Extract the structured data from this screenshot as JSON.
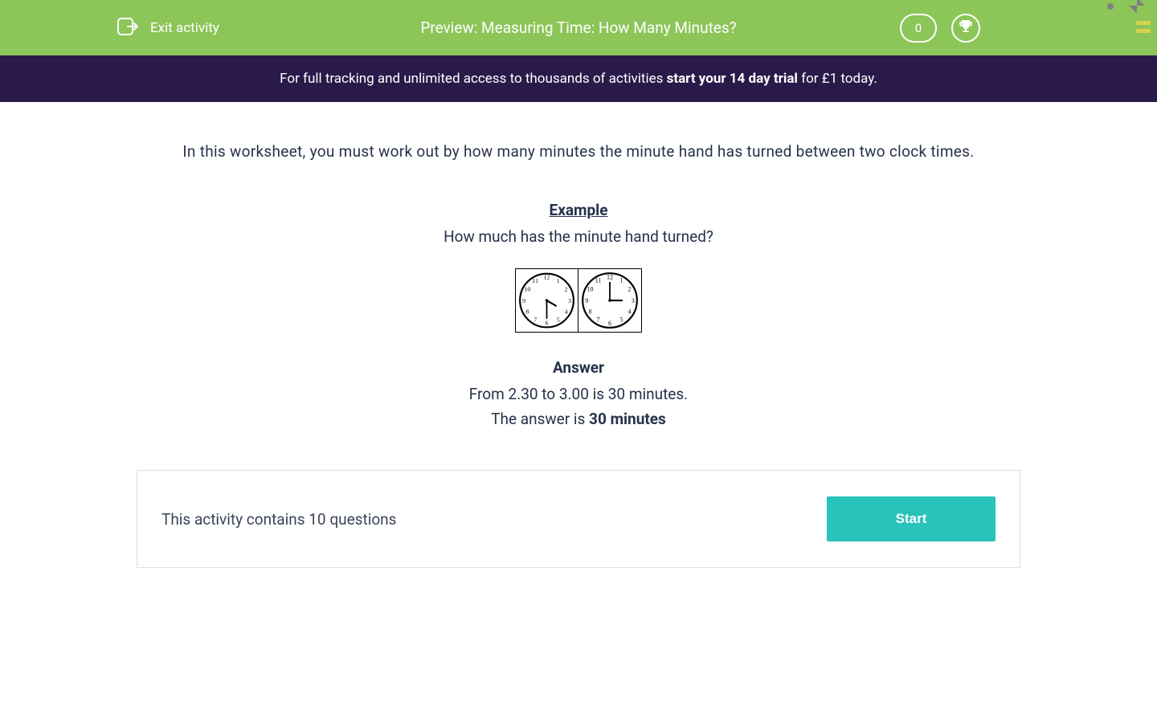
{
  "header": {
    "exit_label": "Exit activity",
    "title": "Preview: Measuring Time: How Many Minutes?",
    "score": "0"
  },
  "banner": {
    "prefix": "For full tracking and unlimited access to thousands of activities ",
    "bold": "start your 14 day trial",
    "suffix": " for £1 today."
  },
  "content": {
    "intro": "In this worksheet, you must work out by how many minutes the minute hand has turned between two clock times.",
    "example_heading": "Example",
    "example_question": "How much has the minute hand turned?",
    "clocks": [
      {
        "hour": 2,
        "minute": 30
      },
      {
        "hour": 3,
        "minute": 0
      }
    ],
    "answer_heading": "Answer",
    "answer_line1": "From 2.30 to 3.00 is 30 minutes.",
    "answer_final_prefix": "The answer is ",
    "answer_final_bold": "30 minutes"
  },
  "action": {
    "questions_text": "This activity contains 10 questions",
    "start_label": "Start"
  }
}
